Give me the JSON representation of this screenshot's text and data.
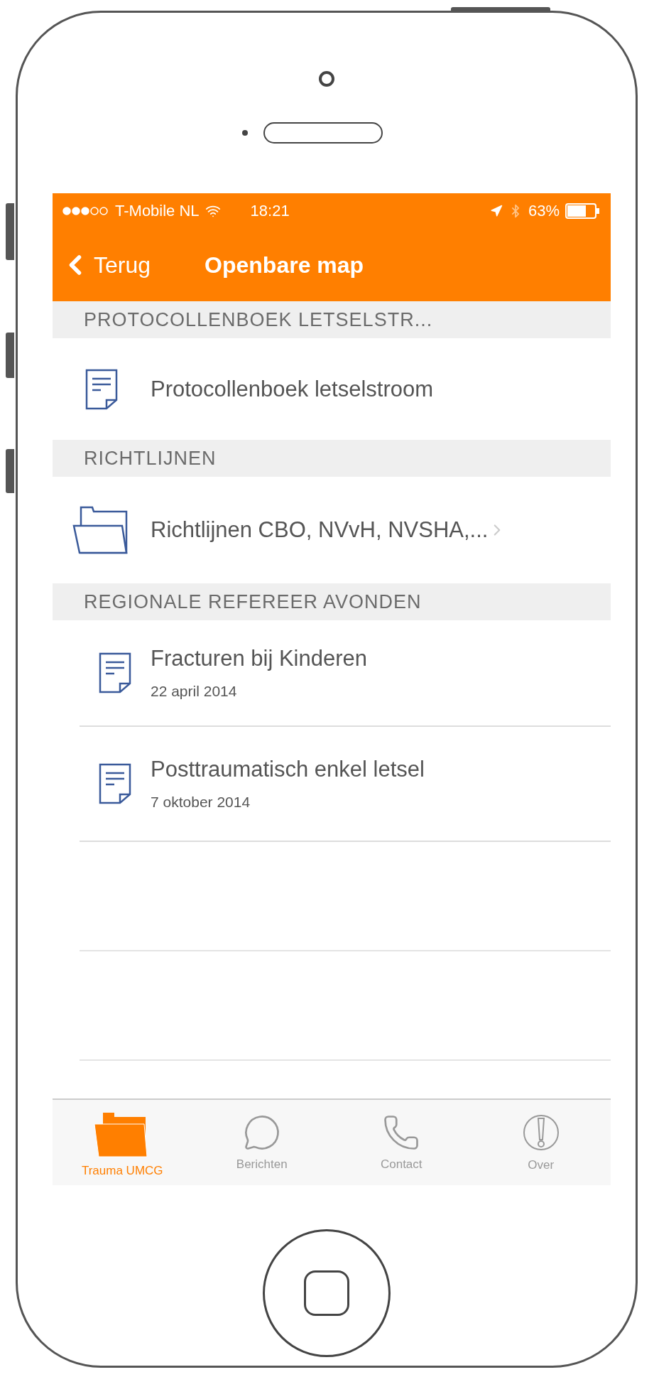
{
  "status_bar": {
    "carrier": "T-Mobile NL",
    "time": "18:21",
    "battery": "63%"
  },
  "nav_bar": {
    "back": "Terug",
    "title": "Openbare map"
  },
  "sections": [
    {
      "title": "PROTOCOLLENBOEK LETSELSTR...",
      "items": [
        {
          "kind": "document",
          "title": "Protocollenboek letselstroom"
        }
      ]
    },
    {
      "title": "RICHTLIJNEN",
      "items": [
        {
          "kind": "folder",
          "title": "Richtlijnen CBO, NVvH, NVSHA,..."
        }
      ]
    },
    {
      "title": "REGIONALE REFEREER AVONDEN",
      "items": [
        {
          "kind": "document",
          "title": "Fracturen bij Kinderen",
          "subtitle": "22 april 2014"
        },
        {
          "kind": "document",
          "title": "Posttraumatisch enkel letsel",
          "subtitle": "7 oktober 2014"
        }
      ]
    }
  ],
  "tab_bar": [
    {
      "kind": "folder",
      "label": "Trauma UMCG",
      "selected": true
    },
    {
      "kind": "messages",
      "label": "Berichten",
      "selected": false
    },
    {
      "kind": "phone",
      "label": "Contact",
      "selected": false
    },
    {
      "kind": "info",
      "label": "Over",
      "selected": false
    }
  ]
}
